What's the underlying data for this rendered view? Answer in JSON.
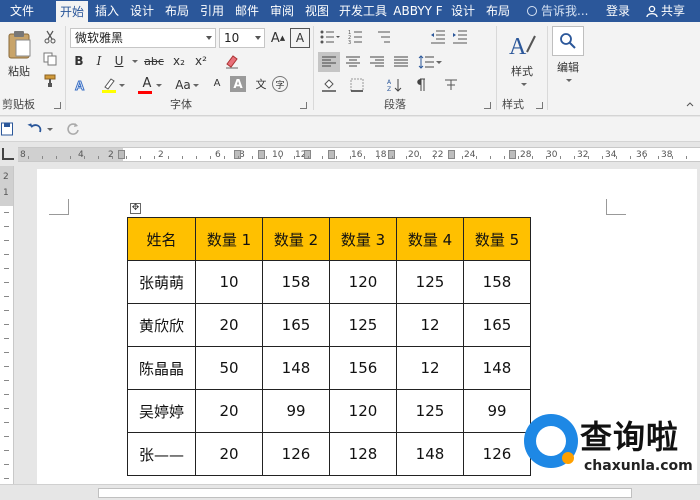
{
  "tabs": [
    {
      "label": "文件",
      "active": false
    },
    {
      "label": "开始",
      "active": true
    },
    {
      "label": "插入",
      "active": false
    },
    {
      "label": "设计",
      "active": false
    },
    {
      "label": "布局",
      "active": false
    },
    {
      "label": "引用",
      "active": false
    },
    {
      "label": "邮件",
      "active": false
    },
    {
      "label": "审阅",
      "active": false
    },
    {
      "label": "视图",
      "active": false
    },
    {
      "label": "开发工具",
      "active": false
    },
    {
      "label": "ABBYY F",
      "active": false
    },
    {
      "label": "设计",
      "active": false
    },
    {
      "label": "布局",
      "active": false
    }
  ],
  "tell_me": "告诉我...",
  "sign_in": "登录",
  "share": "共享",
  "ribbon": {
    "clipboard": {
      "paste_label": "粘贴",
      "group_label": "剪贴板"
    },
    "font": {
      "font_name": "微软雅黑",
      "font_size": "10",
      "group_label": "字体",
      "bold": "B",
      "italic": "I",
      "underline": "U",
      "strike": "abc",
      "subscript": "x₂",
      "superscript": "x²",
      "grow": "A",
      "case_label": "Aa",
      "font_color_letter": "A",
      "char_shading_letter": "A",
      "phonetic_letter": "文",
      "circle_char": "字",
      "highlight_color": "#ffff00",
      "font_color": "#ff0000"
    },
    "paragraph": {
      "group_label": "段落"
    },
    "styles": {
      "label": "样式",
      "group_label": "样式"
    },
    "editing": {
      "label": "编辑"
    }
  },
  "ruler": {
    "numbers": [
      "8",
      "4",
      "2",
      "2",
      "6",
      "8",
      "10",
      "12",
      "16",
      "18",
      "20",
      "22",
      "24",
      "28",
      "30",
      "32",
      "34",
      "36",
      "38"
    ]
  },
  "vruler": {
    "numbers": [
      "2",
      "1"
    ]
  },
  "table": {
    "headers": [
      "姓名",
      "数量 1",
      "数量 2",
      "数量 3",
      "数量 4",
      "数量 5"
    ],
    "header_color": "#ffc000",
    "rows": [
      [
        "张萌萌",
        "10",
        "158",
        "120",
        "125",
        "158"
      ],
      [
        "黄欣欣",
        "20",
        "165",
        "125",
        "12",
        "165"
      ],
      [
        "陈晶晶",
        "50",
        "148",
        "156",
        "12",
        "148"
      ],
      [
        "吴婷婷",
        "20",
        "99",
        "120",
        "125",
        "99"
      ],
      [
        "张——",
        "20",
        "126",
        "128",
        "148",
        "126"
      ]
    ]
  },
  "watermark": {
    "title": "查询啦",
    "subtitle": "chaxunla.com"
  }
}
